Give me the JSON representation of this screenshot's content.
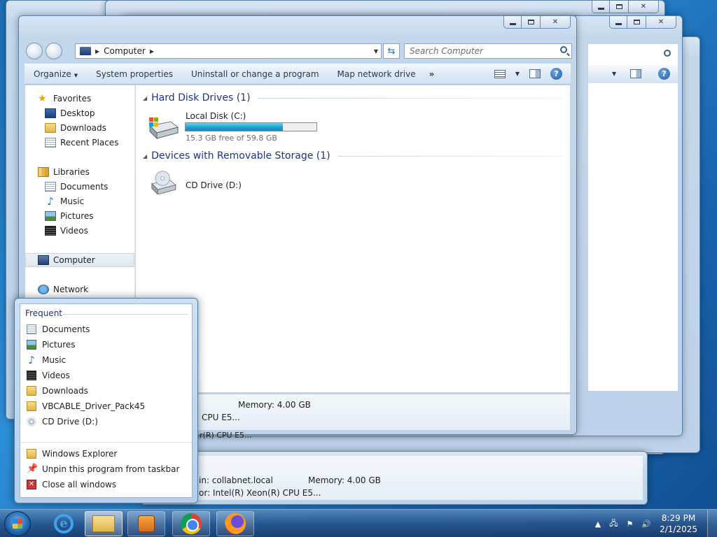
{
  "explorer": {
    "address_crumb": "Computer",
    "search_placeholder": "Search Computer",
    "commands": [
      "Organize",
      "System properties",
      "Uninstall or change a program",
      "Map network drive",
      "»"
    ],
    "nav": {
      "favorites": "Favorites",
      "desktop": "Desktop",
      "downloads": "Downloads",
      "recent_places": "Recent Places",
      "libraries": "Libraries",
      "documents": "Documents",
      "music": "Music",
      "pictures": "Pictures",
      "videos": "Videos",
      "computer": "Computer",
      "network": "Network"
    },
    "groups": {
      "hdd": "Hard Disk Drives (1)",
      "removable": "Devices with Removable Storage (1)"
    },
    "local_disk": {
      "name": "Local Disk (C:)",
      "free_text": "15.3 GB free of 59.8 GB",
      "used_fraction": 0.744
    },
    "cd_drive": "CD Drive (D:)",
    "status": {
      "memory": "Memory: 4.00 GB",
      "cpu": "CPU E5..."
    }
  },
  "back_windows": {
    "cpu_fragment": "r(R) CPU E5...",
    "domain": "in: collabnet.local",
    "memory": "Memory: 4.00 GB",
    "processor": "or: Intel(R) Xeon(R) CPU E5..."
  },
  "jump_list": {
    "header": "Frequent",
    "frequent": [
      "Documents",
      "Pictures",
      "Music",
      "Videos",
      "Downloads",
      "VBCABLE_Driver_Pack45",
      "CD Drive (D:)"
    ],
    "tasks": [
      "Windows Explorer",
      "Unpin this program from taskbar",
      "Close all windows"
    ]
  },
  "taskbar": {
    "time": "8:29 PM",
    "date": "2/1/2025"
  }
}
